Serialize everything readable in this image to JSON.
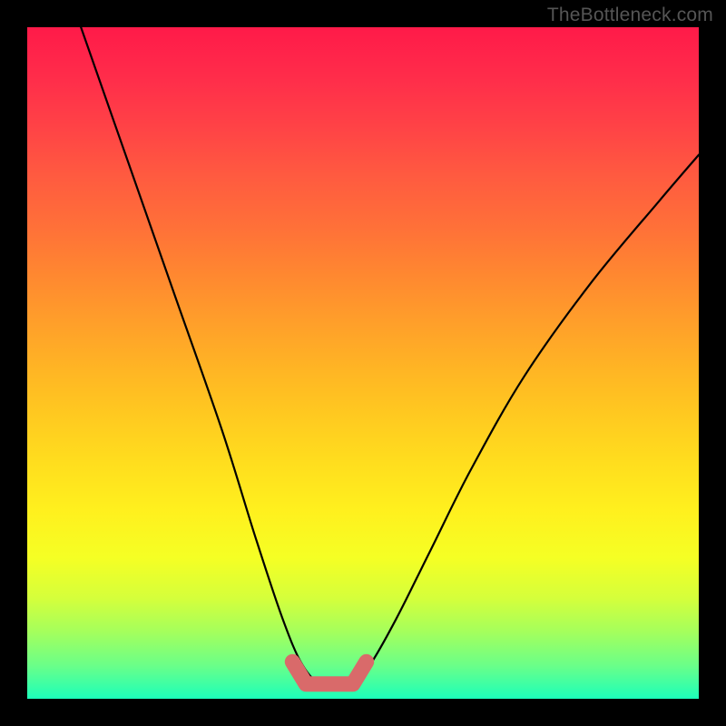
{
  "watermark": "TheBottleneck.com",
  "chart_data": {
    "type": "line",
    "title": "",
    "xlabel": "",
    "ylabel": "",
    "xlim": [
      0,
      100
    ],
    "ylim": [
      0,
      100
    ],
    "series": [
      {
        "name": "bottleneck-curve",
        "path_pts": [
          [
            8,
            100
          ],
          [
            15,
            80
          ],
          [
            22,
            60
          ],
          [
            29,
            40
          ],
          [
            34,
            24
          ],
          [
            38,
            12
          ],
          [
            41,
            5
          ],
          [
            44,
            2
          ],
          [
            48,
            2
          ],
          [
            51,
            5
          ],
          [
            55,
            12
          ],
          [
            60,
            22
          ],
          [
            66,
            34
          ],
          [
            74,
            48
          ],
          [
            84,
            62
          ],
          [
            94,
            74
          ],
          [
            100,
            81
          ]
        ]
      },
      {
        "name": "highlight-band",
        "path_pts": [
          [
            39.5,
            5.5
          ],
          [
            41.5,
            2.2
          ],
          [
            48.5,
            2.2
          ],
          [
            50.5,
            5.5
          ]
        ]
      }
    ]
  }
}
